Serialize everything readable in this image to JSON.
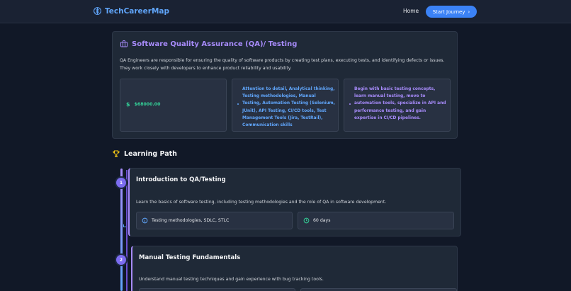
{
  "header": {
    "logo_text": "TechCareerMap",
    "nav_home": "Home",
    "cta_label": "Start Journey",
    "brand_color": "#60a5fa",
    "cta_color": "#3b82f6"
  },
  "career": {
    "title": "Software Quality Assurance (QA)/ Testing",
    "description": "QA Engineers are responsible for ensuring the quality of software products by creating test plans, executing tests, and identifying defects or issues. They work closely with developers to enhance product reliability and usability.",
    "salary": "$68000.00",
    "salary_symbol": "$",
    "skills": "Attention to detail, Analytical thinking, Testing methodologies, Manual Testing, Automation Testing (Selenium, JUnit), API Testing, CI/CD tools, Test Management Tools (Jira, TestRail), Communication skills",
    "advice": "Begin with basic testing concepts, learn manual testing, move to automation tools, specialize in API and performance testing, and gain expertise in CI/CD pipelines.",
    "accent_color": "#a78bfa",
    "salary_color": "#34d399"
  },
  "learning_path": {
    "heading": "Learning Path",
    "steps": [
      {
        "number": "1",
        "title": "Introduction to QA/Testing",
        "description": "Learn the basics of software testing, including testing methodologies and the role of QA in software development.",
        "topics": "Testing methodologies, SDLC, STLC",
        "duration": "60 days"
      },
      {
        "number": "2",
        "title": "Manual Testing Fundamentals",
        "description": "Understand manual testing techniques and gain experience with bug tracking tools.",
        "topics": "",
        "duration": ""
      }
    ]
  },
  "icons": {
    "logo": "brain-icon",
    "career": "briefcase-icon",
    "salary": "dollar-icon",
    "learning_path": "trophy-icon",
    "topics": "info-icon",
    "duration": "clock-icon",
    "cta": "chevron-right-icon"
  }
}
